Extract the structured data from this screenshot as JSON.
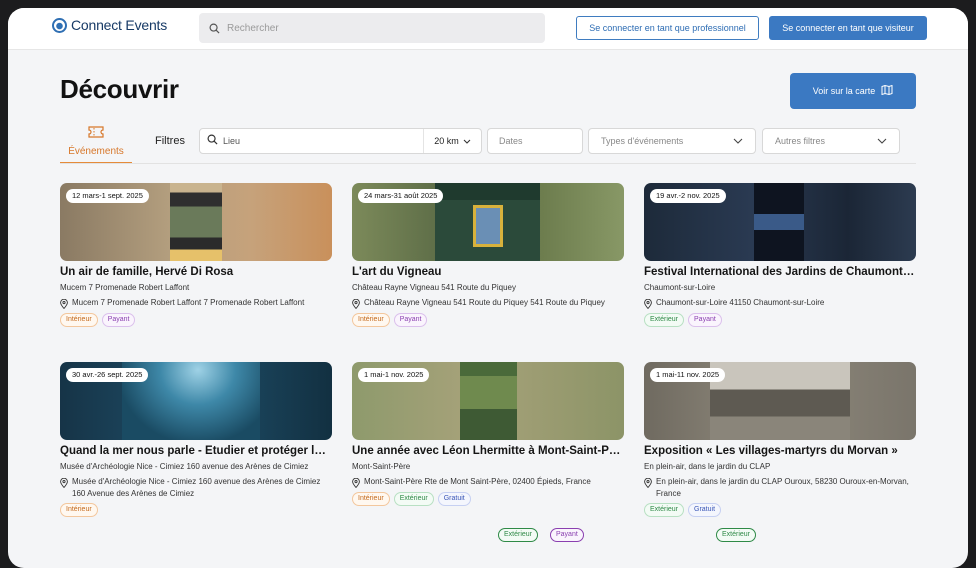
{
  "header": {
    "logo_text": "Connect Events",
    "search_placeholder": "Rechercher",
    "pro_login": "Se connecter en tant que professionnel",
    "visitor_login": "Se connecter en tant que visiteur"
  },
  "page": {
    "title": "Découvrir",
    "map_button": "Voir sur la carte"
  },
  "tabs": [
    {
      "label": "Événements",
      "active": true,
      "icon": "ticket-icon"
    }
  ],
  "filters": {
    "label": "Filtres",
    "location_placeholder": "Lieu",
    "radius": "20 km",
    "dates_placeholder": "Dates",
    "types_placeholder": "Types d'événements",
    "other_placeholder": "Autres filtres"
  },
  "colors": {
    "primary": "#3b79c2",
    "accent": "#e58b3a",
    "tag_interieur": "#c46a1c",
    "tag_payant": "#8a3fb0",
    "tag_exterieur": "#2f8a47",
    "tag_gratuit": "#3b57b7"
  },
  "events": [
    {
      "date": "12 mars-1 sept. 2025",
      "title": "Un air de famille, Hervé Di Rosa",
      "venue": "Mucem 7 Promenade Robert Laffont",
      "address": "Mucem 7 Promenade Robert Laffont 7 Promenade Robert Laffont",
      "tags": [
        "Intérieur",
        "Payant"
      ]
    },
    {
      "date": "24 mars-31 août 2025",
      "title": "L'art du Vigneau",
      "venue": "Château Rayne Vigneau 541 Route du Piquey",
      "address": "Château Rayne Vigneau 541 Route du Piquey 541 Route du Piquey",
      "tags": [
        "Intérieur",
        "Payant"
      ]
    },
    {
      "date": "19 avr.-2 nov. 2025",
      "title": "Festival International des Jardins de Chaumont-sur-Loire",
      "venue": "Chaumont-sur-Loire",
      "address": "Chaumont-sur-Loire 41150 Chaumont-sur-Loire",
      "tags": [
        "Extérieur",
        "Payant"
      ]
    },
    {
      "date": "30 avr.-26 sept. 2025",
      "title": "Quand la mer nous parle - Étudier et protéger le littoral",
      "venue": "Musée d'Archéologie Nice - Cimiez 160 avenue des Arènes de Cimiez",
      "address": "Musée d'Archéologie Nice - Cimiez 160 avenue des Arènes de Cimiez 160 Avenue des Arènes de Cimiez",
      "tags": [
        "Intérieur"
      ]
    },
    {
      "date": "1 mai-1 nov. 2025",
      "title": "Une année avec Léon Lhermitte à Mont-Saint-Père",
      "venue": "Mont-Saint-Père",
      "address": "Mont-Saint-Père Rte de Mont Saint-Père, 02400 Épieds, France",
      "tags": [
        "Intérieur",
        "Extérieur",
        "Gratuit"
      ]
    },
    {
      "date": "1 mai-11 nov. 2025",
      "title": "Exposition « Les villages-martyrs du Morvan »",
      "venue": "En plein-air, dans le jardin du CLAP",
      "address": "En plein-air, dans le jardin du CLAP Ouroux, 58230 Ouroux-en-Morvan, France",
      "tags": [
        "Extérieur",
        "Gratuit"
      ]
    }
  ],
  "overflow_tags": [
    "Extérieur",
    "Payant",
    "Extérieur"
  ]
}
